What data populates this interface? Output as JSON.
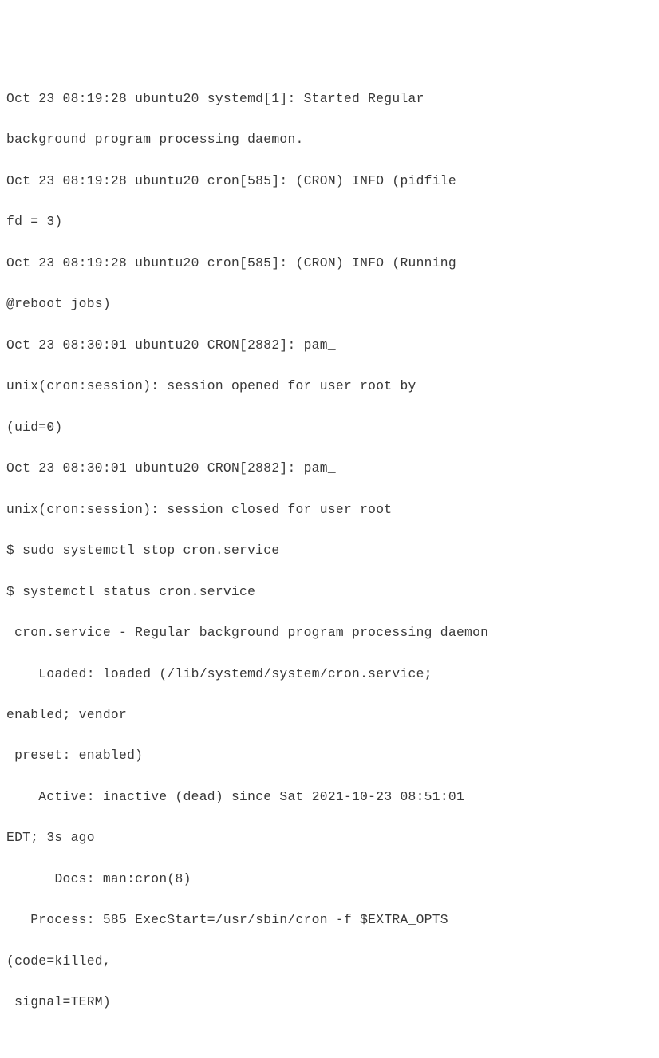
{
  "lines": [
    "Oct 23 08:19:28 ubuntu20 systemd[1]: Started Regular",
    "background program processing daemon.",
    "Oct 23 08:19:28 ubuntu20 cron[585]: (CRON) INFO (pidfile",
    "fd = 3)",
    "Oct 23 08:19:28 ubuntu20 cron[585]: (CRON) INFO (Running",
    "@reboot jobs)",
    "Oct 23 08:30:01 ubuntu20 CRON[2882]: pam_",
    "unix(cron:session): session opened for user root by",
    "(uid=0)",
    "Oct 23 08:30:01 ubuntu20 CRON[2882]: pam_",
    "unix(cron:session): session closed for user root",
    "$ sudo systemctl stop cron.service",
    "$ systemctl status cron.service",
    " cron.service - Regular background program processing daemon",
    "    Loaded: loaded (/lib/systemd/system/cron.service;",
    "enabled; vendor",
    " preset: enabled)",
    "    Active: inactive (dead) since Sat 2021-10-23 08:51:01",
    "EDT; 3s ago",
    "      Docs: man:cron(8)",
    "   Process: 585 ExecStart=/usr/sbin/cron -f $EXTRA_OPTS",
    "(code=killed,",
    " signal=TERM)"
  ]
}
